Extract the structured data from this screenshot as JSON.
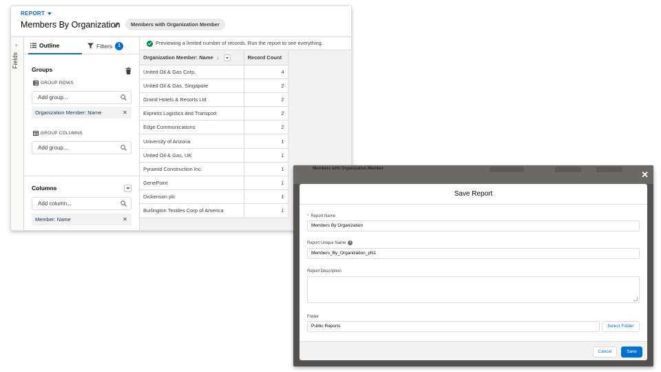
{
  "report_builder": {
    "eyebrow": "REPORT",
    "title": "Members By Organization",
    "report_type_pill": "Members with Organization Member",
    "fields_rail_label": "Fields",
    "tabs": {
      "outline": "Outline",
      "filters": "Filters",
      "filters_count": "1"
    },
    "groups": {
      "title": "Groups",
      "group_rows_label": "GROUP ROWS",
      "group_rows_placeholder": "Add group...",
      "group_rows_chip": "Organization Member: Name",
      "group_columns_label": "GROUP COLUMNS",
      "group_columns_placeholder": "Add group..."
    },
    "columns": {
      "title": "Columns",
      "placeholder": "Add column...",
      "chip": "Member: Name"
    },
    "preview_note": "Previewing a limited number of records. Run the report to see everything.",
    "table": {
      "headers": [
        "Organization Member: Name",
        "Record Count"
      ],
      "sort_indicator": "↓",
      "rows": [
        {
          "name": "United Oil & Gas Corp.",
          "count": "4"
        },
        {
          "name": "United Oil & Gas, Singapore",
          "count": "2"
        },
        {
          "name": "Grand Hotels & Resorts Ltd",
          "count": "2"
        },
        {
          "name": "Express Logistics and Transport",
          "count": "2"
        },
        {
          "name": "Edge Communications",
          "count": "2"
        },
        {
          "name": "University of Arizona",
          "count": "1"
        },
        {
          "name": "United Oil & Gas, UK",
          "count": "1"
        },
        {
          "name": "Pyramid Construction Inc.",
          "count": "1"
        },
        {
          "name": "GenePoint",
          "count": "1"
        },
        {
          "name": "Dickenson plc",
          "count": "1"
        },
        {
          "name": "Burlington Textiles Corp of America",
          "count": "1"
        }
      ]
    }
  },
  "save_modal": {
    "background_strip_text": "Members with Organization Member",
    "close_icon": "close-icon",
    "title": "Save Report",
    "fields": {
      "report_name_required_mark": "*",
      "report_name_label": "Report Name",
      "report_name_value": "Members By Organization",
      "unique_name_label": "Report Unique Name",
      "unique_name_value": "Members_By_Organization_pN1",
      "description_label": "Report Description",
      "description_value": "",
      "folder_label": "Folder",
      "folder_value": "Public Reports",
      "select_folder_button": "Select Folder"
    },
    "buttons": {
      "cancel": "Cancel",
      "save": "Save"
    }
  },
  "colors": {
    "brand_blue": "#0070d2",
    "success_green": "#04844b",
    "required_red": "#c23934",
    "modal_backdrop": "#54514e"
  }
}
